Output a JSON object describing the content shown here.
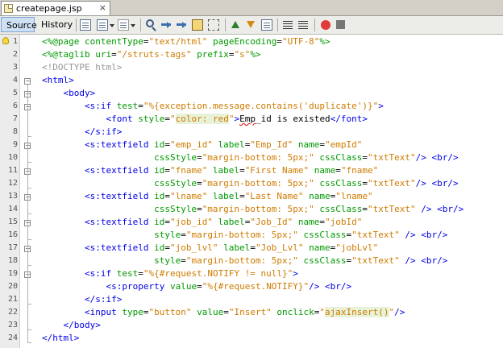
{
  "tab": {
    "filename": "createpage.jsp",
    "close": "×"
  },
  "toolbar": {
    "source_label": "Source",
    "history_label": "History"
  },
  "lines": [
    {
      "n": "1",
      "segs": [
        [
          "dir",
          "<%@page "
        ],
        [
          "atn",
          "contentType"
        ],
        [
          "",
          "="
        ],
        [
          "atv",
          "\"text/html\""
        ],
        [
          "atn",
          " pageEncoding"
        ],
        [
          "",
          "="
        ],
        [
          "atv",
          "\"UTF-8\""
        ],
        [
          "dir",
          "%>"
        ]
      ]
    },
    {
      "n": "2",
      "segs": [
        [
          "dir",
          "<%@taglib "
        ],
        [
          "atn",
          "uri"
        ],
        [
          "",
          "="
        ],
        [
          "atv",
          "\"/struts-tags\""
        ],
        [
          "atn",
          " prefix"
        ],
        [
          "",
          "="
        ],
        [
          "atv",
          "\"s\""
        ],
        [
          "dir",
          "%>"
        ]
      ]
    },
    {
      "n": "3",
      "segs": [
        [
          "cmt",
          "<!DOCTYPE html>"
        ]
      ]
    },
    {
      "n": "4",
      "segs": [
        [
          "tag",
          "<html>"
        ]
      ]
    },
    {
      "n": "5",
      "segs": [
        [
          "",
          "    "
        ],
        [
          "tag",
          "<body>"
        ]
      ]
    },
    {
      "n": "6",
      "segs": [
        [
          "",
          "        "
        ],
        [
          "tag",
          "<s:if "
        ],
        [
          "atn",
          "test"
        ],
        [
          "",
          "="
        ],
        [
          "atv",
          "\"%{exception.message.contains('duplicate')}\""
        ],
        [
          "tag",
          ">"
        ]
      ]
    },
    {
      "n": "7",
      "segs": [
        [
          "",
          "            "
        ],
        [
          "tag",
          "<font "
        ],
        [
          "atn",
          "style"
        ],
        [
          "",
          "="
        ],
        [
          "atv",
          "\""
        ],
        [
          "hl",
          "color: red"
        ],
        [
          "atv",
          "\""
        ],
        [
          "tag",
          ">"
        ],
        [
          "err",
          "Emp"
        ],
        [
          "",
          "_id is existed"
        ],
        [
          "tag",
          "</font>"
        ]
      ]
    },
    {
      "n": "8",
      "segs": [
        [
          "",
          "        "
        ],
        [
          "tag",
          "</s:if>"
        ]
      ]
    },
    {
      "n": "9",
      "segs": [
        [
          "",
          "        "
        ],
        [
          "tag",
          "<s:textfield "
        ],
        [
          "atn",
          "id"
        ],
        [
          "",
          "="
        ],
        [
          "atv",
          "\"emp_id\""
        ],
        [
          "atn",
          " label"
        ],
        [
          "",
          "="
        ],
        [
          "atv",
          "\"Emp_Id\""
        ],
        [
          "atn",
          " name"
        ],
        [
          "",
          "="
        ],
        [
          "atv",
          "\"empId\""
        ]
      ]
    },
    {
      "n": "10",
      "segs": [
        [
          "",
          "                     "
        ],
        [
          "atn",
          "cssStyle"
        ],
        [
          "",
          "="
        ],
        [
          "atv",
          "\"margin-bottom: 5px;\""
        ],
        [
          "atn",
          " cssClass"
        ],
        [
          "",
          "="
        ],
        [
          "atv",
          "\"txtText\""
        ],
        [
          "tag",
          "/> <br/>"
        ]
      ]
    },
    {
      "n": "11",
      "segs": [
        [
          "",
          "        "
        ],
        [
          "tag",
          "<s:textfield "
        ],
        [
          "atn",
          "id"
        ],
        [
          "",
          "="
        ],
        [
          "atv",
          "\"fname\""
        ],
        [
          "atn",
          " label"
        ],
        [
          "",
          "="
        ],
        [
          "atv",
          "\"First Name\""
        ],
        [
          "atn",
          " name"
        ],
        [
          "",
          "="
        ],
        [
          "atv",
          "\"fname\""
        ]
      ]
    },
    {
      "n": "12",
      "segs": [
        [
          "",
          "                     "
        ],
        [
          "atn",
          "cssStyle"
        ],
        [
          "",
          "="
        ],
        [
          "atv",
          "\"margin-bottom: 5px;\""
        ],
        [
          "atn",
          " cssClass"
        ],
        [
          "",
          "="
        ],
        [
          "atv",
          "\"txtText\""
        ],
        [
          "tag",
          "/> <br/>"
        ]
      ]
    },
    {
      "n": "13",
      "segs": [
        [
          "",
          "        "
        ],
        [
          "tag",
          "<s:textfield "
        ],
        [
          "atn",
          "id"
        ],
        [
          "",
          "="
        ],
        [
          "atv",
          "\"lname\""
        ],
        [
          "atn",
          " label"
        ],
        [
          "",
          "="
        ],
        [
          "atv",
          "\"Last Name\""
        ],
        [
          "atn",
          " name"
        ],
        [
          "",
          "="
        ],
        [
          "atv",
          "\"lname\""
        ]
      ]
    },
    {
      "n": "14",
      "segs": [
        [
          "",
          "                     "
        ],
        [
          "atn",
          "cssStyle"
        ],
        [
          "",
          "="
        ],
        [
          "atv",
          "\"margin-bottom: 5px;\""
        ],
        [
          "atn",
          " cssClass"
        ],
        [
          "",
          "="
        ],
        [
          "atv",
          "\"txtText\""
        ],
        [
          "tag",
          " /> <br/>"
        ]
      ]
    },
    {
      "n": "15",
      "segs": [
        [
          "",
          "        "
        ],
        [
          "tag",
          "<s:textfield "
        ],
        [
          "atn",
          "id"
        ],
        [
          "",
          "="
        ],
        [
          "atv",
          "\"job_id\""
        ],
        [
          "atn",
          " label"
        ],
        [
          "",
          "="
        ],
        [
          "atv",
          "\"Job_Id\""
        ],
        [
          "atn",
          " name"
        ],
        [
          "",
          "="
        ],
        [
          "atv",
          "\"jobId\""
        ]
      ]
    },
    {
      "n": "16",
      "segs": [
        [
          "",
          "                     "
        ],
        [
          "atn",
          "style"
        ],
        [
          "",
          "="
        ],
        [
          "atv",
          "\"margin-bottom: 5px;\""
        ],
        [
          "atn",
          " cssClass"
        ],
        [
          "",
          "="
        ],
        [
          "atv",
          "\"txtText\""
        ],
        [
          "tag",
          " /> <br/>"
        ]
      ]
    },
    {
      "n": "17",
      "segs": [
        [
          "",
          "        "
        ],
        [
          "tag",
          "<s:textfield "
        ],
        [
          "atn",
          "id"
        ],
        [
          "",
          "="
        ],
        [
          "atv",
          "\"job_lvl\""
        ],
        [
          "atn",
          " label"
        ],
        [
          "",
          "="
        ],
        [
          "atv",
          "\"Job_Lvl\""
        ],
        [
          "atn",
          " name"
        ],
        [
          "",
          "="
        ],
        [
          "atv",
          "\"jobLvl\""
        ]
      ]
    },
    {
      "n": "18",
      "segs": [
        [
          "",
          "                     "
        ],
        [
          "atn",
          "style"
        ],
        [
          "",
          "="
        ],
        [
          "atv",
          "\"margin-bottom: 5px;\""
        ],
        [
          "atn",
          " cssClass"
        ],
        [
          "",
          "="
        ],
        [
          "atv",
          "\"txtText\""
        ],
        [
          "tag",
          " /> <br/>"
        ]
      ]
    },
    {
      "n": "19",
      "segs": [
        [
          "",
          "        "
        ],
        [
          "tag",
          "<s:if "
        ],
        [
          "atn",
          "test"
        ],
        [
          "",
          "="
        ],
        [
          "atv",
          "\"%{#request.NOTIFY != null}\""
        ],
        [
          "tag",
          ">"
        ]
      ]
    },
    {
      "n": "20",
      "segs": [
        [
          "",
          "            "
        ],
        [
          "tag",
          "<s:property "
        ],
        [
          "atn",
          "value"
        ],
        [
          "",
          "="
        ],
        [
          "atv",
          "\"%{#request.NOTIFY}\""
        ],
        [
          "tag",
          "/> <br/>"
        ]
      ]
    },
    {
      "n": "21",
      "segs": [
        [
          "",
          "        "
        ],
        [
          "tag",
          "</s:if>"
        ]
      ]
    },
    {
      "n": "22",
      "segs": [
        [
          "",
          "        "
        ],
        [
          "tag",
          "<input "
        ],
        [
          "atn",
          "type"
        ],
        [
          "",
          "="
        ],
        [
          "atv",
          "\"button\""
        ],
        [
          "atn",
          " value"
        ],
        [
          "",
          "="
        ],
        [
          "atv",
          "\"Insert\""
        ],
        [
          "atn",
          " onclick"
        ],
        [
          "",
          "="
        ],
        [
          "atv",
          "\""
        ],
        [
          "hl",
          "ajaxInsert()"
        ],
        [
          "atv",
          "\""
        ],
        [
          "tag",
          "/>"
        ]
      ]
    },
    {
      "n": "23",
      "segs": [
        [
          "",
          "    "
        ],
        [
          "tag",
          "</body>"
        ]
      ]
    },
    {
      "n": "24",
      "segs": [
        [
          "tag",
          "</html>"
        ]
      ]
    }
  ],
  "colors": {
    "tag": "#0000e6",
    "attr_name": "#009900",
    "attr_value": "#ce7b00",
    "comment": "#969696"
  }
}
